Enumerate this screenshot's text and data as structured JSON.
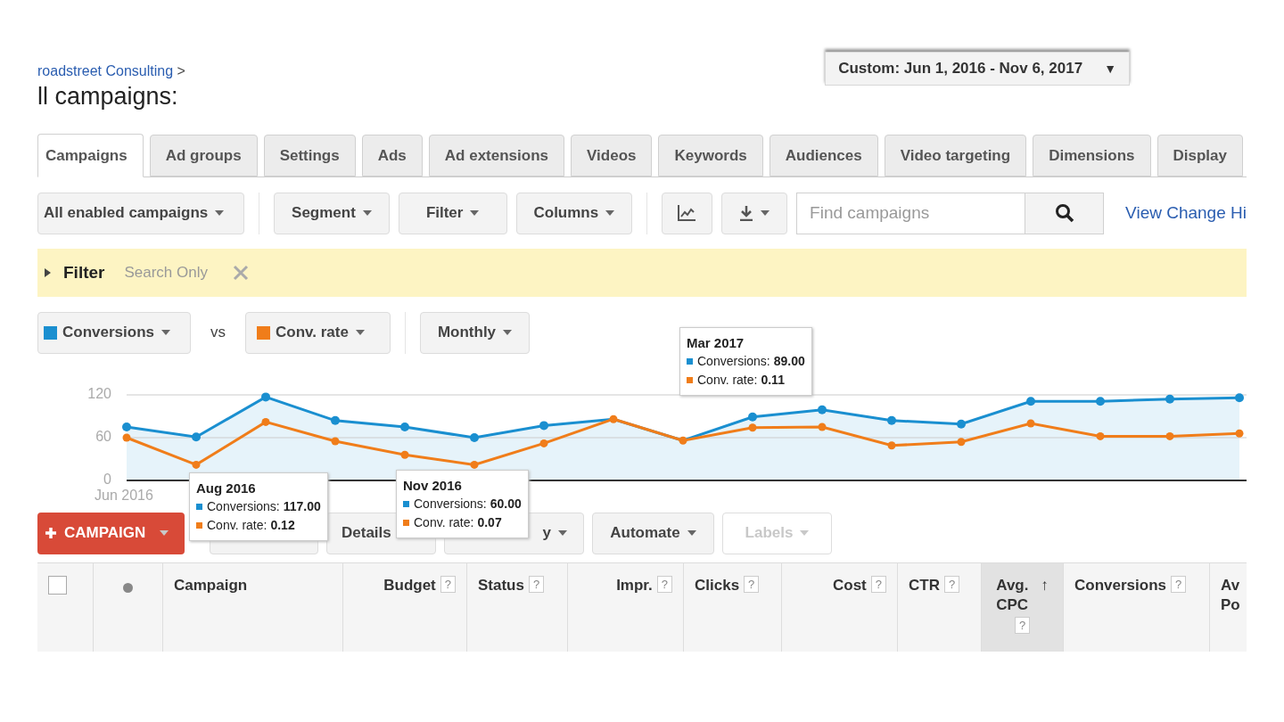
{
  "breadcrumb": {
    "link": "roadstreet Consulting",
    "separator": ">"
  },
  "title": "ll campaigns:",
  "date_range": {
    "label": "Custom: Jun 1, 2016 - Nov 6, 2017",
    "caret": "▼"
  },
  "tabs": [
    {
      "label": "Campaigns",
      "selected": true
    },
    {
      "label": "Ad groups",
      "selected": false
    },
    {
      "label": "Settings",
      "selected": false
    },
    {
      "label": "Ads",
      "selected": false
    },
    {
      "label": "Ad extensions",
      "selected": false
    },
    {
      "label": "Videos",
      "selected": false
    },
    {
      "label": "Keywords",
      "selected": false
    },
    {
      "label": "Audiences",
      "selected": false
    },
    {
      "label": "Video targeting",
      "selected": false
    },
    {
      "label": "Dimensions",
      "selected": false
    },
    {
      "label": "Display",
      "selected": false
    }
  ],
  "toolbar": {
    "view": "All enabled campaigns",
    "segment": "Segment",
    "filter": "Filter",
    "columns": "Columns",
    "search": {
      "placeholder": "Find campaigns"
    },
    "link": "View Change Hi"
  },
  "filter_bar": {
    "label": "Filter",
    "value": "Search Only",
    "expanded": false
  },
  "chart_controls": {
    "vs": "vs",
    "period": "Monthly"
  },
  "chart_start_label": "Jun 2016",
  "chart_data": {
    "type": "line",
    "ylim": [
      0,
      120
    ],
    "yticks": [
      {
        "value": 0,
        "label": "0"
      },
      {
        "value": 60,
        "label": "60"
      },
      {
        "value": 120,
        "label": "120"
      }
    ],
    "series": [
      {
        "name": "Conversions",
        "type": "area",
        "marker": "circle",
        "color": "#1a8fd0",
        "values": [
          75,
          61,
          117,
          84,
          75,
          60,
          77,
          86,
          56,
          89,
          99,
          84,
          79,
          111,
          111,
          114,
          116
        ]
      },
      {
        "name": "Conv. rate",
        "type": "line",
        "marker": "circle",
        "color": "#f07d1a",
        "values": [
          60,
          22,
          82,
          55,
          36,
          22,
          52,
          86,
          56,
          74,
          75,
          49,
          54,
          80,
          62,
          62,
          66
        ]
      }
    ]
  },
  "tooltips": [
    {
      "title": "Aug 2016",
      "lines": [
        {
          "label": "Conversions:",
          "value": "117.00",
          "color": "#1a8fd0"
        },
        {
          "label": "Conv. rate:",
          "value": "0.12",
          "color": "#f07d1a"
        }
      ]
    },
    {
      "title": "Nov 2016",
      "lines": [
        {
          "label": "Conversions:",
          "value": "60.00",
          "color": "#1a8fd0"
        },
        {
          "label": "Conv. rate:",
          "value": "0.07",
          "color": "#f07d1a"
        }
      ]
    },
    {
      "title": "Mar 2017",
      "lines": [
        {
          "label": "Conversions:",
          "value": "89.00",
          "color": "#1a8fd0"
        },
        {
          "label": "Conv. rate:",
          "value": "0.11",
          "color": "#f07d1a"
        }
      ]
    }
  ],
  "actions": [
    {
      "kind": "primary",
      "label": "CAMPAIGN",
      "disabled": false
    },
    {
      "kind": "plain",
      "disabled": false
    },
    {
      "kind": "plain",
      "label": "Details",
      "disabled": false
    },
    {
      "kind": "dropdown",
      "label": "y",
      "disabled": false
    },
    {
      "kind": "dropdown",
      "label": "Automate",
      "disabled": false
    },
    {
      "kind": "dropdown",
      "label": "Labels",
      "disabled": true
    }
  ],
  "table": {
    "columns": [
      {
        "kind": "checkbox",
        "checked": false
      },
      {
        "kind": "dot"
      },
      {
        "kind": "text",
        "label": "Campaign"
      },
      {
        "kind": "number",
        "label": "Budget",
        "help": "?"
      },
      {
        "kind": "text",
        "label": "Status",
        "help": "?"
      },
      {
        "kind": "number",
        "label": "Impr.",
        "help": "?"
      },
      {
        "kind": "text",
        "label": "Clicks",
        "help": "?"
      },
      {
        "kind": "number",
        "label": "Cost",
        "help": "?"
      },
      {
        "kind": "text",
        "label": "CTR",
        "help": "?"
      },
      {
        "kind": "text",
        "label": "Avg. CPC",
        "help": "?",
        "sorted": true,
        "sort_mark": "↑"
      },
      {
        "kind": "text",
        "label": "Conversions",
        "help": "?"
      },
      {
        "kind": "text",
        "label": "Av Po"
      }
    ]
  }
}
